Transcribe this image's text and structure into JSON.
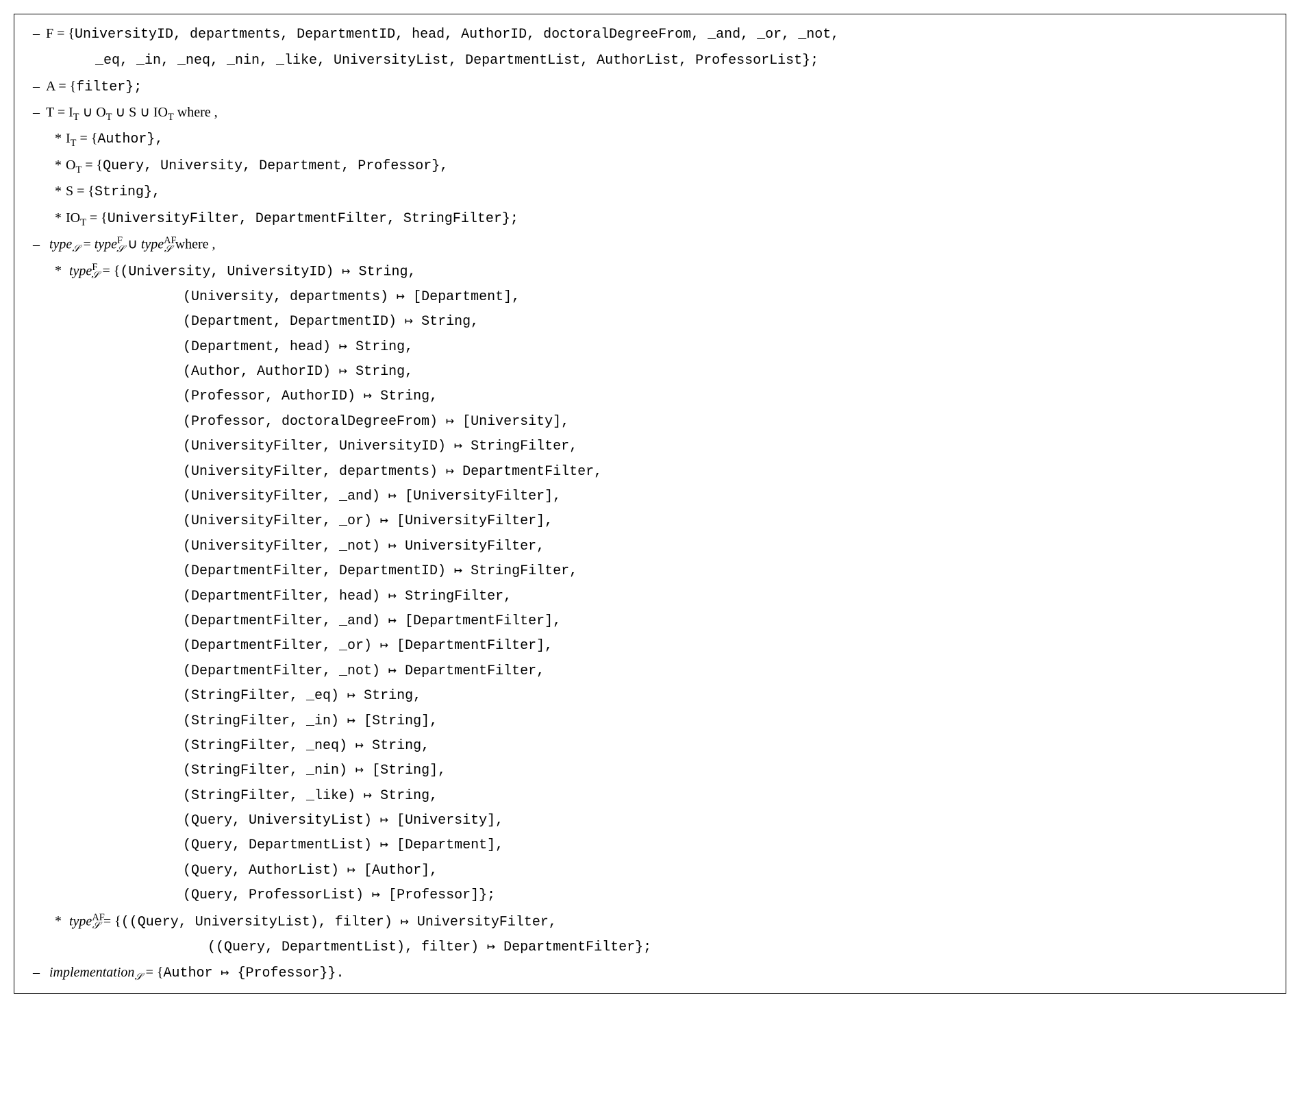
{
  "l1a": "F = {",
  "l1b": "UniversityID, departments, DepartmentID, head, AuthorID, doctoralDegreeFrom, _and, _or, _not,",
  "l1cont": "_eq, _in, _neq, _nin, _like, UniversityList, DepartmentList, AuthorList, ProfessorList};",
  "l2a": "A = {",
  "l2b": "filter};",
  "l3a": "T = I",
  "l3b": " ∪ O",
  "l3c": " ∪ S ∪ IO",
  "l3where": "  where ,",
  "l_IT_a": "I",
  "l_IT_b": " = {",
  "l_IT_c": "Author},",
  "l_OT_a": "O",
  "l_OT_b": " = {",
  "l_OT_c": "Query, University, Department, Professor},",
  "l_S_a": "S = {",
  "l_S_b": "String},",
  "l_IOT_a": "IO",
  "l_IOT_b": " = {",
  "l_IOT_c": "UniversityFilter, DepartmentFilter, StringFilter};",
  "l_type_main_a": "type",
  "l_type_main_b": " = ",
  "l_type_main_c": "type",
  "l_type_main_d": " ∪ ",
  "l_type_main_e": "type",
  "l_type_main_where": "  where ,",
  "typeF_head": " = {",
  "typeF": [
    "(University, UniversityID) ↦ String,",
    "(University, departments) ↦ [Department],",
    "(Department, DepartmentID) ↦ String,",
    "(Department, head) ↦ String,",
    "(Author, AuthorID) ↦ String,",
    "(Professor, AuthorID) ↦ String,",
    "(Professor, doctoralDegreeFrom) ↦ [University],",
    "(UniversityFilter, UniversityID) ↦ StringFilter,",
    "(UniversityFilter, departments) ↦ DepartmentFilter,",
    "(UniversityFilter, _and) ↦ [UniversityFilter],",
    "(UniversityFilter, _or) ↦ [UniversityFilter],",
    "(UniversityFilter, _not) ↦ UniversityFilter,",
    "(DepartmentFilter, DepartmentID) ↦ StringFilter,",
    "(DepartmentFilter, head) ↦ StringFilter,",
    "(DepartmentFilter, _and) ↦ [DepartmentFilter],",
    "(DepartmentFilter, _or) ↦ [DepartmentFilter],",
    "(DepartmentFilter, _not) ↦ DepartmentFilter,",
    "(StringFilter, _eq) ↦ String,",
    "(StringFilter, _in) ↦ [String],",
    "(StringFilter, _neq) ↦ String,",
    "(StringFilter, _nin) ↦ [String],",
    "(StringFilter, _like) ↦ String,",
    "(Query, UniversityList) ↦ [University],",
    "(Query, DepartmentList) ↦ [Department],",
    "(Query, AuthorList) ↦ [Author],",
    "(Query, ProfessorList) ↦ [Professor]};"
  ],
  "typeAF_head": " = {",
  "typeAF": [
    "((Query, UniversityList), filter) ↦ UniversityFilter,",
    "((Query, DepartmentList), filter) ↦ DepartmentFilter};"
  ],
  "impl_a": "implementation",
  "impl_b": " = {",
  "impl_c": "Author ↦ {Professor}}.",
  "sub_T": "T",
  "sub_S": "𝒮",
  "sup_F": "F",
  "sup_AF": "AF",
  "type_word": "type"
}
